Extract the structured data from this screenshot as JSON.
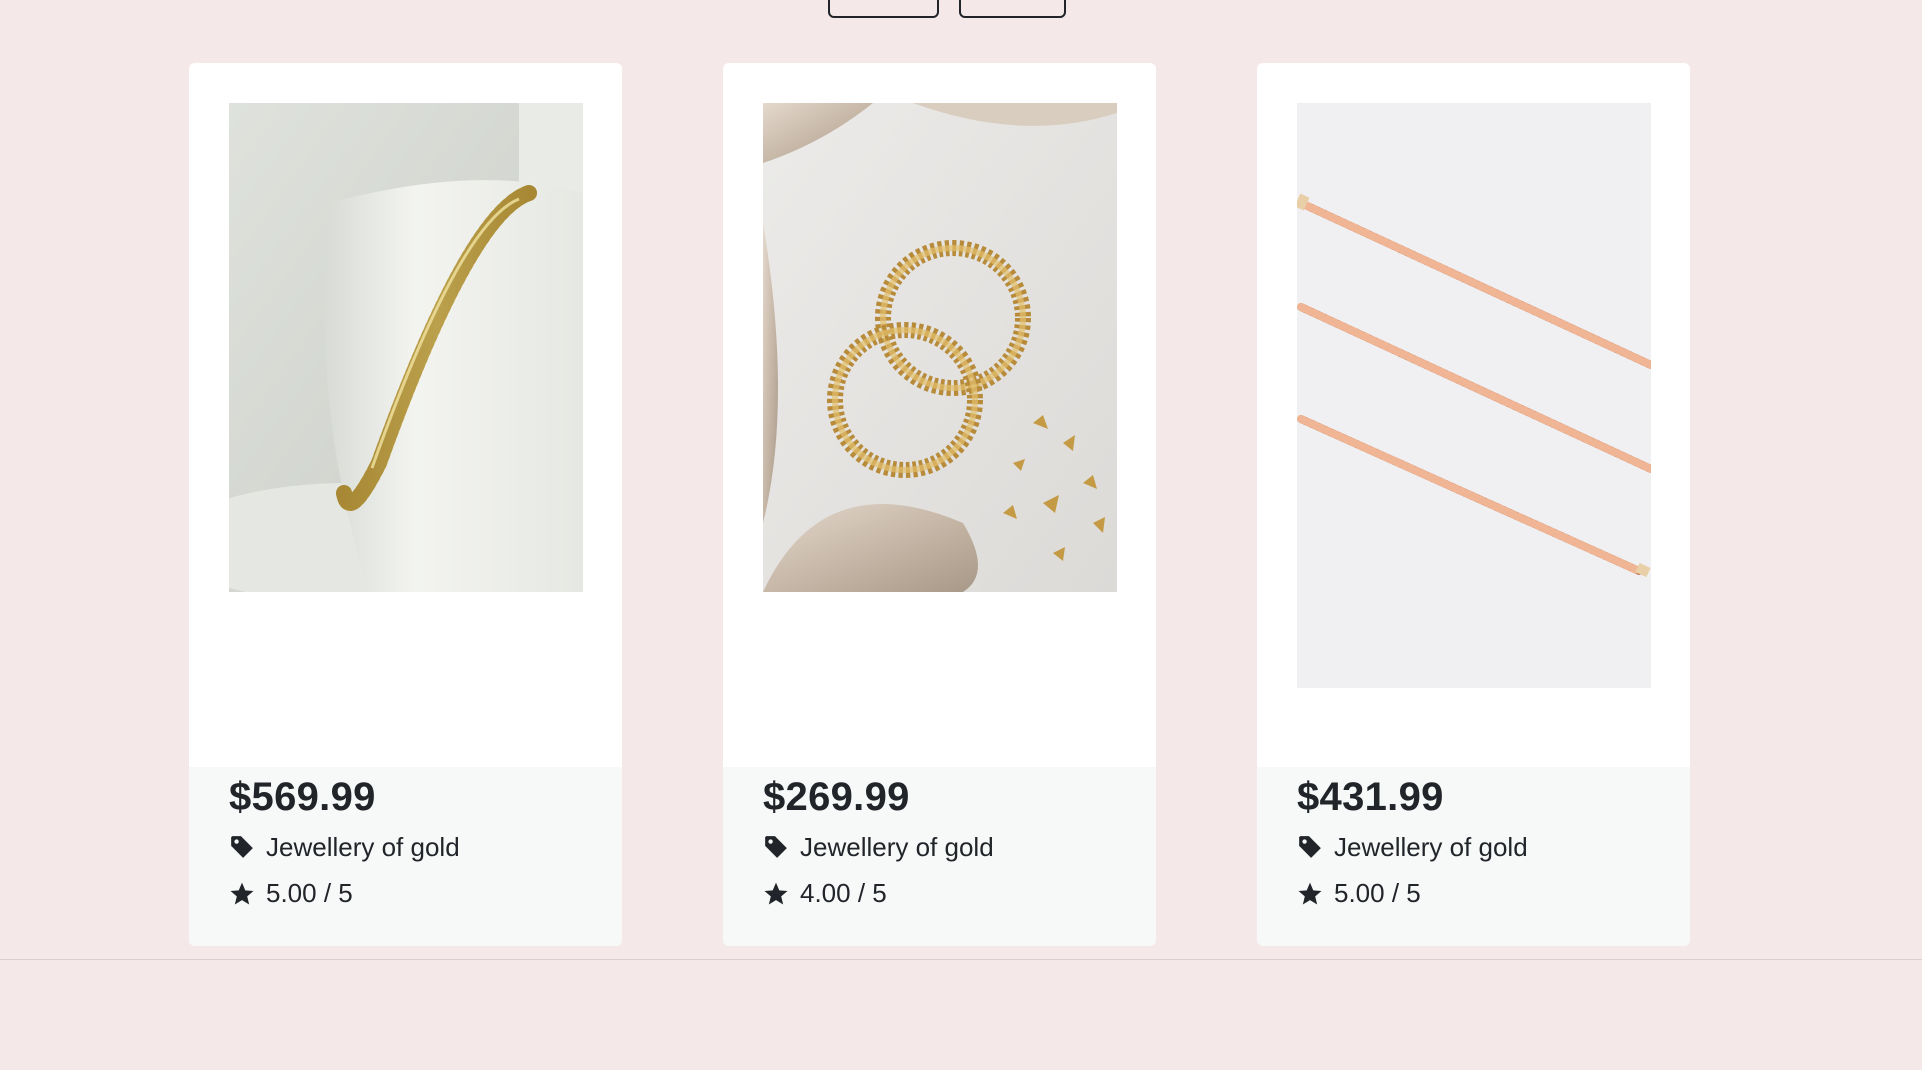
{
  "top_buttons": [
    "",
    ""
  ],
  "products": [
    {
      "price": "$569.99",
      "category": "Jewellery of gold",
      "rating": "5.00 / 5",
      "image": "gold-rope-bracelet"
    },
    {
      "price": "$269.99",
      "category": "Jewellery of gold",
      "rating": "4.00 / 5",
      "image": "gold-hoop-earrings"
    },
    {
      "price": "$431.99",
      "category": "Jewellery of gold",
      "rating": "5.00 / 5",
      "image": "rose-gold-rope-chain"
    }
  ],
  "colors": {
    "background": "#f5e8e9",
    "card": "#ffffff",
    "card_footer": "#f7f8f8",
    "text": "#212529",
    "gold": "#c9a85c",
    "rose_gold": "#d98f6c"
  }
}
